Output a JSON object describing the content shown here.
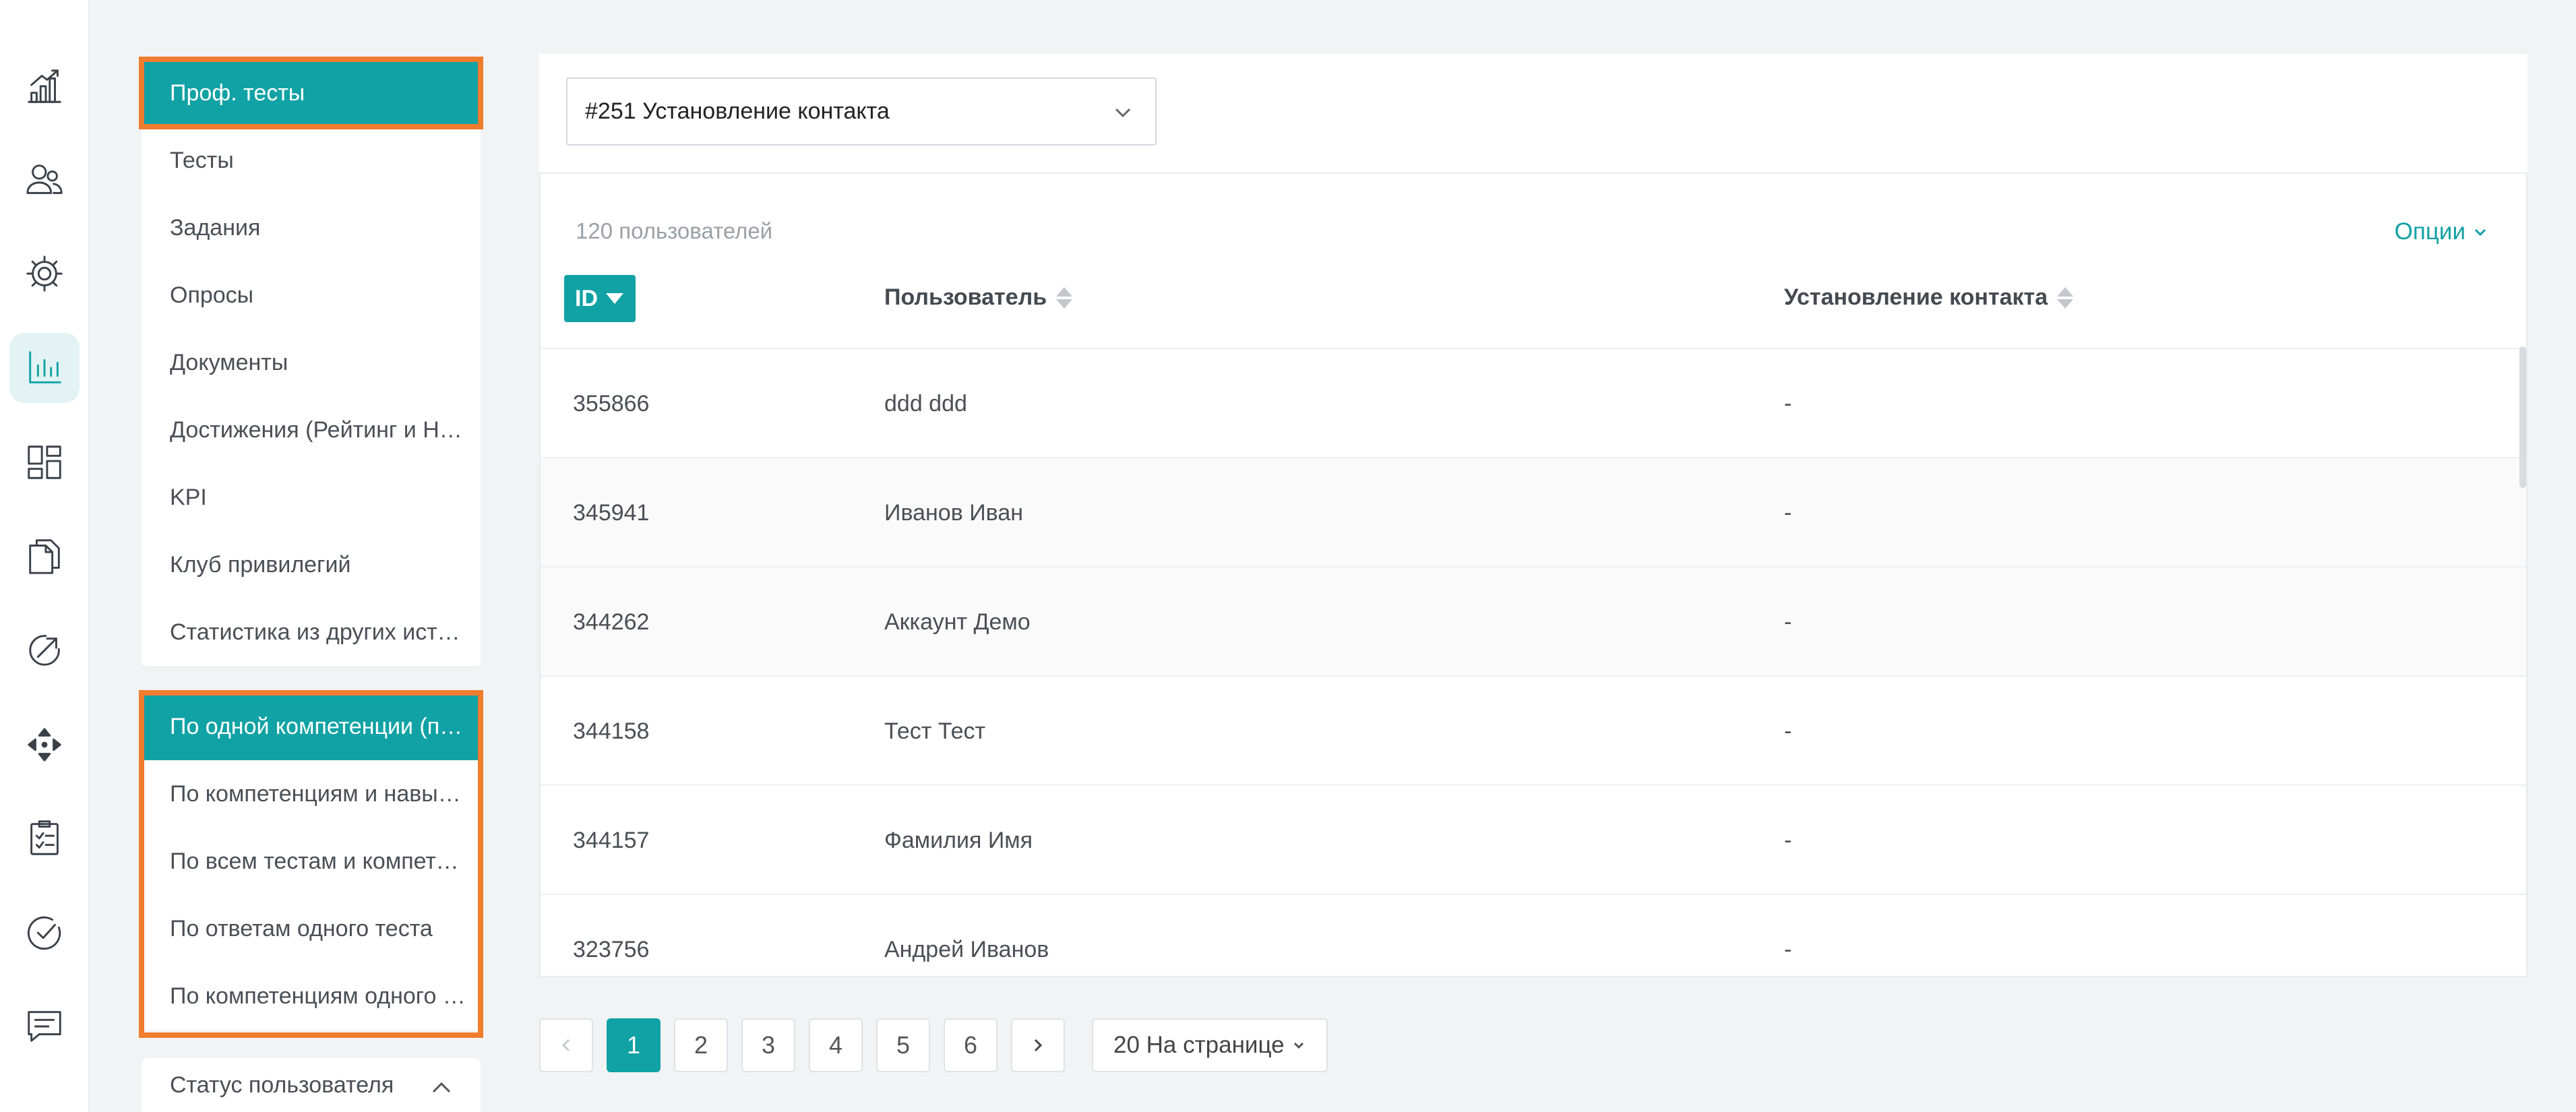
{
  "rail": {
    "icons": [
      {
        "name": "analytics-chart-icon",
        "active": false
      },
      {
        "name": "users-icon",
        "active": false
      },
      {
        "name": "gear-icon",
        "active": false
      },
      {
        "name": "bar-chart-icon",
        "active": true
      },
      {
        "name": "dashboard-icon",
        "active": false
      },
      {
        "name": "documents-icon",
        "active": false
      },
      {
        "name": "arrow-circle-icon",
        "active": false
      },
      {
        "name": "move-arrows-icon",
        "active": false
      },
      {
        "name": "checklist-icon",
        "active": false
      },
      {
        "name": "check-circle-icon",
        "active": false
      },
      {
        "name": "chat-icon",
        "active": false
      }
    ]
  },
  "menu_primary": {
    "items": [
      {
        "label": "Проф. тесты",
        "active": true
      },
      {
        "label": "Тесты",
        "active": false
      },
      {
        "label": "Задания",
        "active": false
      },
      {
        "label": "Опросы",
        "active": false
      },
      {
        "label": "Документы",
        "active": false
      },
      {
        "label": "Достижения (Рейтинг и Награды)",
        "active": false
      },
      {
        "label": "KPI",
        "active": false
      },
      {
        "label": "Клуб привилегий",
        "active": false
      },
      {
        "label": "Статистика из других источников",
        "active": false
      }
    ]
  },
  "menu_reports": {
    "items": [
      {
        "label": "По одной компетенции (пользователи)",
        "active": true
      },
      {
        "label": "По компетенциям и навыкам",
        "active": false
      },
      {
        "label": "По всем тестам и компетенциям",
        "active": false
      },
      {
        "label": "По ответам одного теста",
        "active": false
      },
      {
        "label": "По компетенциям одного теста",
        "active": false
      }
    ]
  },
  "status_panel": {
    "label": "Статус пользователя"
  },
  "competency_select": {
    "value": "#251 Установление контакта"
  },
  "table": {
    "count_label": "120 пользователей",
    "options_label": "Опции",
    "headers": {
      "id": "ID",
      "user": "Пользователь",
      "competency": "Установление контакта"
    },
    "rows": [
      {
        "id": "355866",
        "user": "ddd ddd",
        "value": "-"
      },
      {
        "id": "345941",
        "user": "Иванов Иван",
        "value": "-"
      },
      {
        "id": "344262",
        "user": "Аккаунт Демо",
        "value": "-"
      },
      {
        "id": "344158",
        "user": "Тест Тест",
        "value": "-"
      },
      {
        "id": "344157",
        "user": "Фамилия Имя",
        "value": "-"
      },
      {
        "id": "323756",
        "user": "Андрей Иванов",
        "value": "-"
      }
    ]
  },
  "pagination": {
    "pages": [
      "1",
      "2",
      "3",
      "4",
      "5",
      "6"
    ],
    "current": "1",
    "per_page_label": "20 На странице"
  },
  "colors": {
    "accent": "#11a2a5",
    "highlight": "#f07c2e",
    "background": "#f2f3f5"
  }
}
